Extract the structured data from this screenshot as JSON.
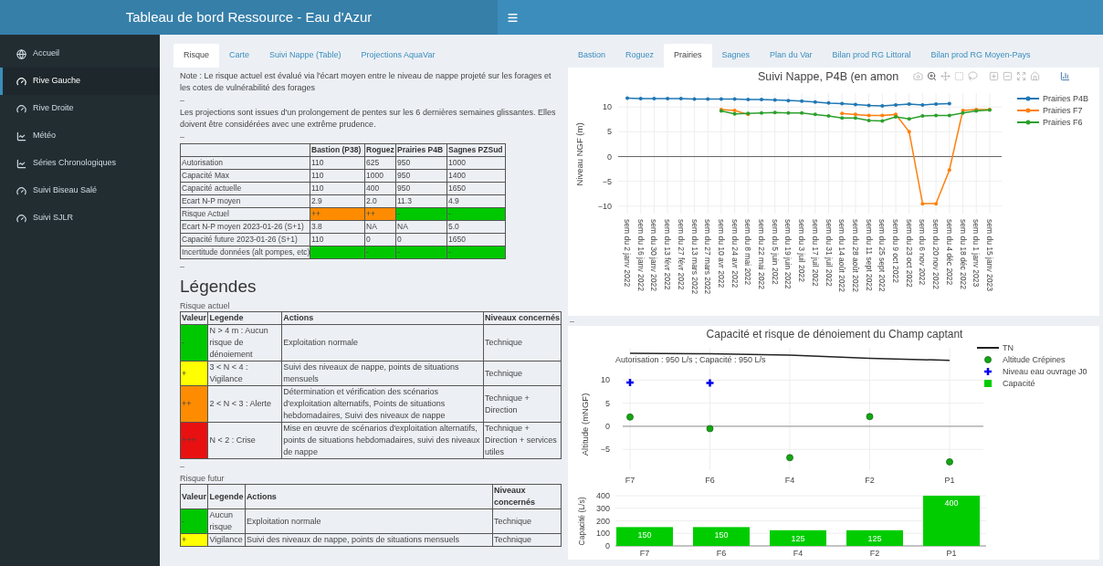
{
  "header": {
    "title": "Tableau de bord Ressource - Eau d'Azur"
  },
  "sidebar": {
    "items": [
      {
        "label": "Accueil",
        "kind": "globe",
        "selected": false
      },
      {
        "label": "Rive Gauche",
        "kind": "gauge",
        "selected": true
      },
      {
        "label": "Rive Droite",
        "kind": "gauge",
        "selected": false
      },
      {
        "label": "Météo",
        "kind": "chart",
        "selected": false
      },
      {
        "label": "Séries Chronologiques",
        "kind": "chart",
        "selected": false
      },
      {
        "label": "Suivi Biseau Salé",
        "kind": "gauge",
        "selected": false
      },
      {
        "label": "Suivi SJLR",
        "kind": "gauge",
        "selected": false
      }
    ]
  },
  "left_panel": {
    "tabs": [
      {
        "label": "Risque",
        "selected": true
      },
      {
        "label": "Carte",
        "selected": false
      },
      {
        "label": "Suivi Nappe (Table)",
        "selected": false
      },
      {
        "label": "Projections AquaVar",
        "selected": false
      }
    ],
    "content": [
      {
        "kind": "text",
        "text": "Note : Le risque actuel est évalué via l'écart moyen entre le niveau de nappe projeté sur les forages et les cotes de vulnérabilité des forages"
      },
      {
        "kind": "dash",
        "text": "–"
      },
      {
        "kind": "text",
        "text": "Les projections sont issues d'un prolongement de pentes sur les 6 dernières semaines glissantes. Elles doivent être considérées avec une extrême prudence."
      },
      {
        "kind": "dash",
        "text": "–"
      },
      {
        "kind": "risk_table",
        "columns": [
          "Bastion (P38)",
          "Roguez",
          "Prairies P4B",
          "Sagnes PZSud"
        ],
        "rows": [
          {
            "label": "Autorisation",
            "cells": [
              {
                "text": "110"
              },
              {
                "text": "625"
              },
              {
                "text": "950"
              },
              {
                "text": "1000"
              }
            ]
          },
          {
            "label": "Capacité Max",
            "cells": [
              {
                "text": "110"
              },
              {
                "text": "1000"
              },
              {
                "text": "950"
              },
              {
                "text": "1400"
              }
            ]
          },
          {
            "label": "Capacité actuelle",
            "cells": [
              {
                "text": "110"
              },
              {
                "text": "400"
              },
              {
                "text": "950"
              },
              {
                "text": "1650"
              }
            ]
          },
          {
            "label": "Ecart N-P moyen",
            "cells": [
              {
                "text": "2.9"
              },
              {
                "text": "2.0"
              },
              {
                "text": "11.3"
              },
              {
                "text": "4.9"
              }
            ]
          },
          {
            "label": "Risque Actuel",
            "cells": [
              {
                "text": "++",
                "color": "#ff8c00"
              },
              {
                "text": "++",
                "color": "#ff8c00"
              },
              {
                "text": "-",
                "color": "#00c800"
              },
              {
                "text": "-",
                "color": "#00c800"
              }
            ]
          },
          {
            "label": "Ecart N-P moyen 2023-01-26 (S+1)",
            "cells": [
              {
                "text": "3.8"
              },
              {
                "text": "NA"
              },
              {
                "text": "NA"
              },
              {
                "text": "5.0"
              }
            ]
          },
          {
            "label": "Capacité future 2023-01-26 (S+1)",
            "cells": [
              {
                "text": "110"
              },
              {
                "text": "0"
              },
              {
                "text": "0"
              },
              {
                "text": "1650"
              }
            ]
          },
          {
            "label": "Incertitude données (alt pompes, etc)",
            "cells": [
              {
                "color": "#00c800"
              },
              {
                "text": "-",
                "color": "#00c800"
              },
              {
                "text": "-",
                "color": "#00c800"
              },
              {
                "text": "-",
                "color": "#00c800"
              }
            ]
          }
        ]
      },
      {
        "kind": "dash",
        "text": "–"
      },
      {
        "kind": "heading",
        "text": "Légendes"
      },
      {
        "kind": "caption",
        "text": "Risque actuel"
      },
      {
        "kind": "legend_table",
        "columns": [
          "Valeur",
          "Legende",
          "Actions",
          "Niveaux concernés"
        ],
        "rows": [
          {
            "cells": [
              {
                "text": "-",
                "color": "#00c800"
              },
              {
                "text": "N > 4 m : Aucun risque de dénoiement"
              },
              {
                "text": "Exploitation normale"
              },
              {
                "text": "Technique"
              }
            ]
          },
          {
            "cells": [
              {
                "text": "+",
                "color": "#ffff00"
              },
              {
                "text": "3 < N < 4 : Vigilance"
              },
              {
                "text": "Suivi des niveaux de nappe, points de situations mensuels"
              },
              {
                "text": "Technique"
              }
            ]
          },
          {
            "cells": [
              {
                "text": "++",
                "color": "#ff8c00"
              },
              {
                "text": "2 < N < 3 : Alerte"
              },
              {
                "text": "Détermination et vérification des scénarios d'exploitation alternatifs, Points de situations hebdomadaires, Suivi des niveaux de nappe"
              },
              {
                "text": "Technique + Direction"
              }
            ]
          },
          {
            "cells": [
              {
                "text": "+++",
                "color": "#e81010"
              },
              {
                "text": "N < 2 : Crise"
              },
              {
                "text": "Mise en œuvre de scénarios d'exploitation alternatifs, points de situations hebdomadaires, suivi des niveaux de nappe"
              },
              {
                "text": "Technique + Direction + services utiles"
              }
            ]
          }
        ]
      },
      {
        "kind": "dash",
        "text": "–"
      },
      {
        "kind": "caption",
        "text": "Risque futur"
      },
      {
        "kind": "legend_table",
        "columns": [
          "Valeur",
          "Legende",
          "Actions",
          "Niveaux concernés"
        ],
        "rows": [
          {
            "cells": [
              {
                "text": "-",
                "color": "#00c800"
              },
              {
                "text": "Aucun risque"
              },
              {
                "text": "Exploitation normale"
              },
              {
                "text": "Technique"
              }
            ]
          },
          {
            "cells": [
              {
                "text": "+",
                "color": "#ffff00"
              },
              {
                "text": "Vigilance"
              },
              {
                "text": "Suivi des niveaux de nappe, points de situations mensuels"
              },
              {
                "text": "Technique"
              }
            ]
          }
        ]
      }
    ]
  },
  "right_panel": {
    "tabs": [
      {
        "label": "Bastion",
        "selected": false
      },
      {
        "label": "Roguez",
        "selected": false
      },
      {
        "label": "Prairies",
        "selected": true
      },
      {
        "label": "Sagnes",
        "selected": false
      },
      {
        "label": "Plan du Var",
        "selected": false
      },
      {
        "label": "Bilan prod RG Littoral",
        "selected": false
      },
      {
        "label": "Bilan prod RG Moyen-Pays",
        "selected": false
      }
    ],
    "nappe_chart": {
      "chart_data": {
        "type": "line",
        "title": "Suivi Nappe, P4B (en amon",
        "ylabel": "Niveau NGF (m)",
        "ylim": [
          -11.5,
          12.8
        ],
        "yticks": [
          -10,
          -5,
          0,
          5,
          10
        ],
        "grid": true,
        "legend": true,
        "categories": [
          "sem du 2 janv 2022",
          "sem du 16 janv 2022",
          "sem du 30 janv 2022",
          "sem du 13 févr 2022",
          "sem du 27 févr 2022",
          "sem du 13 mars 2022",
          "sem du 27 mars 2022",
          "sem du 10 avr 2022",
          "sem du 24 avr 2022",
          "sem du 8 mai 2022",
          "sem du 22 mai 2022",
          "sem du 5 juin 2022",
          "sem du 19 juin 2022",
          "sem du 3 juil 2022",
          "sem du 17 juil 2022",
          "sem du 31 juil 2022",
          "sem du 14 août 2022",
          "sem du 28 août 2022",
          "sem du 11 sept 2022",
          "sem du 25 sept 2022",
          "sem du 9 oct 2022",
          "sem du 23 oct 2022",
          "sem du 6 nov 2022",
          "sem du 20 nov 2022",
          "sem du 4 déc 2022",
          "sem du 18 déc 2022",
          "sem du 1 janv 2023",
          "sem du 15 janv 2023"
        ],
        "series": [
          {
            "name": "Prairies P4B",
            "color": "#1f77b4",
            "values": [
              11.8,
              11.7,
              11.7,
              11.7,
              11.7,
              11.6,
              11.6,
              11.6,
              11.6,
              11.5,
              11.5,
              11.4,
              11.3,
              11.2,
              11.0,
              10.8,
              10.7,
              10.5,
              10.3,
              10.2,
              10.4,
              10.6,
              10.4,
              10.6,
              10.7,
              null,
              null,
              null
            ]
          },
          {
            "name": "Prairies F7",
            "color": "#ff7f0e",
            "values": [
              null,
              null,
              null,
              null,
              null,
              null,
              null,
              9.5,
              9.3,
              8.5,
              null,
              null,
              null,
              null,
              null,
              null,
              8.7,
              8.5,
              8.3,
              8.3,
              8.5,
              5.0,
              -9.5,
              -9.5,
              -2.7,
              9.3,
              9.5,
              9.5
            ]
          },
          {
            "name": "Prairies F6",
            "color": "#2ca02c",
            "values": [
              null,
              null,
              null,
              null,
              null,
              null,
              null,
              9.2,
              8.6,
              8.7,
              8.8,
              8.9,
              8.8,
              8.8,
              8.5,
              8.2,
              7.8,
              7.8,
              7.3,
              7.2,
              8.0,
              7.6,
              8.2,
              8.3,
              8.3,
              8.8,
              9.2,
              9.4
            ]
          }
        ]
      }
    },
    "separator": "–",
    "champ_chart": {
      "chart_data": {
        "type": "scatter",
        "title": "Capacité et risque de dénoiement du Champ captant",
        "ylabel": "Altitude (mNGF)",
        "ylim": [
          -9.5,
          17
        ],
        "yticks": [
          -5,
          0,
          5,
          10
        ],
        "grid": true,
        "legend": true,
        "categories": [
          "F7",
          "F6",
          "F4",
          "F2",
          "P1"
        ],
        "annotations": [
          "Autorisation : 950 L/s ; Capacité : 950 L/s"
        ],
        "series": [
          {
            "name": "TN",
            "color": "#222222",
            "type": "line",
            "values": [
              15.8,
              15.7,
              15.4,
              14.7,
              14.3
            ]
          },
          {
            "name": "Altitude Crépines",
            "color": "#11a811",
            "type": "scatter",
            "values": [
              2.0,
              -0.5,
              -6.8,
              2.1,
              -7.7
            ]
          },
          {
            "name": "Niveau eau ouvrage J0",
            "color": "#0000ee",
            "type": "scatter",
            "values": [
              9.5,
              9.4,
              null,
              null,
              null
            ]
          }
        ]
      }
    },
    "capacite_chart": {
      "chart_data": {
        "type": "bar",
        "ylabel": "Capacité (L/s)",
        "ylim": [
          0,
          400
        ],
        "yticks": [
          0,
          100,
          200,
          300,
          400
        ],
        "grid": true,
        "data_labels": true,
        "categories": [
          "F7",
          "F6",
          "F4",
          "F2",
          "P1"
        ],
        "series": [
          {
            "name": "Capacité",
            "color": "#00cc00",
            "values": [
              150,
              150,
              125,
              125,
              400
            ]
          }
        ]
      }
    }
  }
}
